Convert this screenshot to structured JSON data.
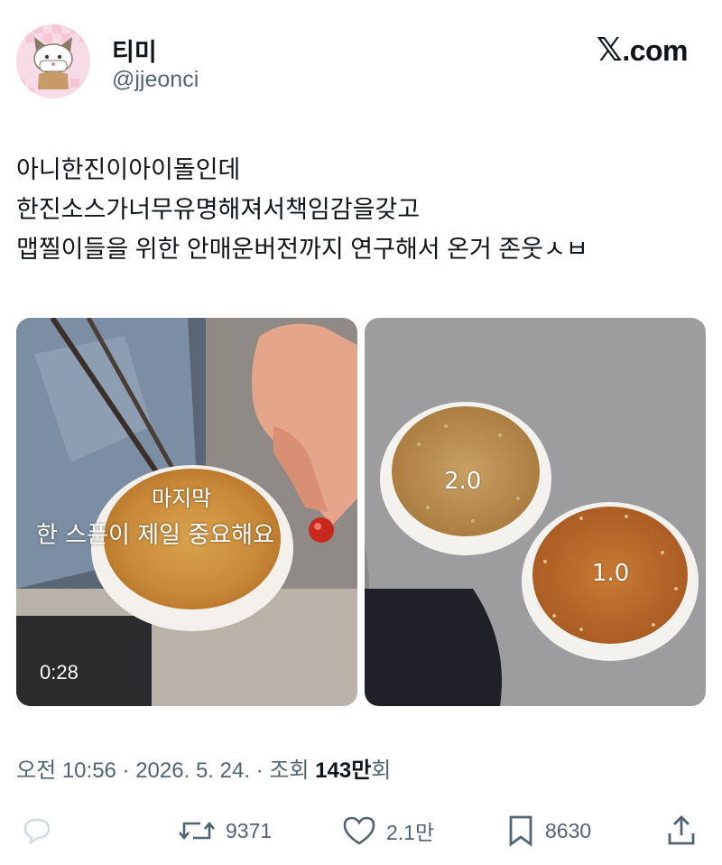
{
  "author": {
    "display_name": "티미",
    "handle": "@jjeonci"
  },
  "brand": {
    "logo_text": ".com"
  },
  "tweet": {
    "lines": [
      "아니한진이아이돌인데",
      "한진소스가너무유명해져서책임감을갖고",
      "맵찔이들을 위한 안매운버전까지 연구해서 온거 존웃ㅅㅂ"
    ]
  },
  "media": {
    "video": {
      "duration": "0:28",
      "caption_line1": "마지막",
      "caption_line2": "한 스푼이 제일 중요해요"
    },
    "photo": {
      "label_bowl1": "2.0",
      "label_bowl2": "1.0"
    }
  },
  "meta": {
    "time": "오전 10:56 · 2026. 5. 24. · 조회 ",
    "views_number": "143만",
    "views_suffix": "회"
  },
  "actions": {
    "retweets": "9371",
    "likes": "2.1만",
    "bookmarks": "8630"
  },
  "colors": {
    "text": "#0f1419",
    "secondary": "#536471",
    "sauce": "#c98a3a"
  }
}
